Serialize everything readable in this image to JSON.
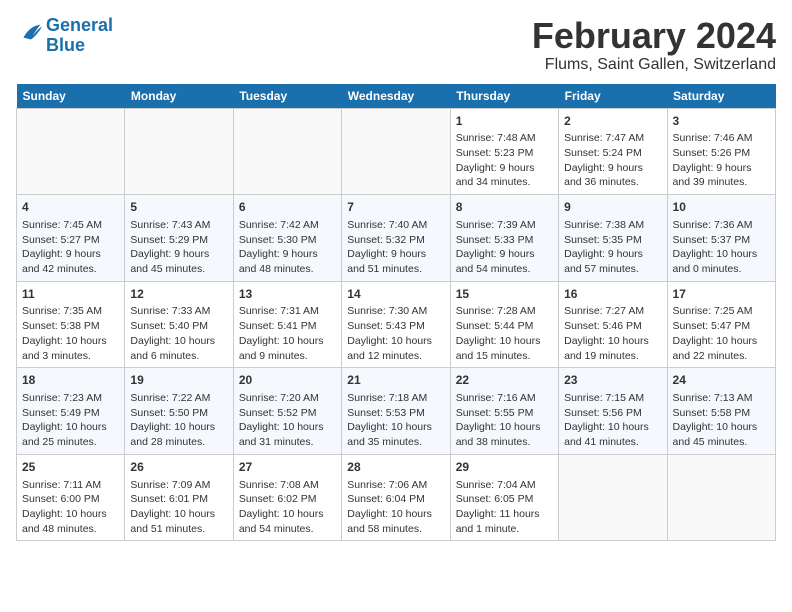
{
  "header": {
    "logo_line1": "General",
    "logo_line2": "Blue",
    "month": "February 2024",
    "location": "Flums, Saint Gallen, Switzerland"
  },
  "days_of_week": [
    "Sunday",
    "Monday",
    "Tuesday",
    "Wednesday",
    "Thursday",
    "Friday",
    "Saturday"
  ],
  "weeks": [
    [
      {
        "day": "",
        "info": ""
      },
      {
        "day": "",
        "info": ""
      },
      {
        "day": "",
        "info": ""
      },
      {
        "day": "",
        "info": ""
      },
      {
        "day": "1",
        "info": "Sunrise: 7:48 AM\nSunset: 5:23 PM\nDaylight: 9 hours and 34 minutes."
      },
      {
        "day": "2",
        "info": "Sunrise: 7:47 AM\nSunset: 5:24 PM\nDaylight: 9 hours and 36 minutes."
      },
      {
        "day": "3",
        "info": "Sunrise: 7:46 AM\nSunset: 5:26 PM\nDaylight: 9 hours and 39 minutes."
      }
    ],
    [
      {
        "day": "4",
        "info": "Sunrise: 7:45 AM\nSunset: 5:27 PM\nDaylight: 9 hours and 42 minutes."
      },
      {
        "day": "5",
        "info": "Sunrise: 7:43 AM\nSunset: 5:29 PM\nDaylight: 9 hours and 45 minutes."
      },
      {
        "day": "6",
        "info": "Sunrise: 7:42 AM\nSunset: 5:30 PM\nDaylight: 9 hours and 48 minutes."
      },
      {
        "day": "7",
        "info": "Sunrise: 7:40 AM\nSunset: 5:32 PM\nDaylight: 9 hours and 51 minutes."
      },
      {
        "day": "8",
        "info": "Sunrise: 7:39 AM\nSunset: 5:33 PM\nDaylight: 9 hours and 54 minutes."
      },
      {
        "day": "9",
        "info": "Sunrise: 7:38 AM\nSunset: 5:35 PM\nDaylight: 9 hours and 57 minutes."
      },
      {
        "day": "10",
        "info": "Sunrise: 7:36 AM\nSunset: 5:37 PM\nDaylight: 10 hours and 0 minutes."
      }
    ],
    [
      {
        "day": "11",
        "info": "Sunrise: 7:35 AM\nSunset: 5:38 PM\nDaylight: 10 hours and 3 minutes."
      },
      {
        "day": "12",
        "info": "Sunrise: 7:33 AM\nSunset: 5:40 PM\nDaylight: 10 hours and 6 minutes."
      },
      {
        "day": "13",
        "info": "Sunrise: 7:31 AM\nSunset: 5:41 PM\nDaylight: 10 hours and 9 minutes."
      },
      {
        "day": "14",
        "info": "Sunrise: 7:30 AM\nSunset: 5:43 PM\nDaylight: 10 hours and 12 minutes."
      },
      {
        "day": "15",
        "info": "Sunrise: 7:28 AM\nSunset: 5:44 PM\nDaylight: 10 hours and 15 minutes."
      },
      {
        "day": "16",
        "info": "Sunrise: 7:27 AM\nSunset: 5:46 PM\nDaylight: 10 hours and 19 minutes."
      },
      {
        "day": "17",
        "info": "Sunrise: 7:25 AM\nSunset: 5:47 PM\nDaylight: 10 hours and 22 minutes."
      }
    ],
    [
      {
        "day": "18",
        "info": "Sunrise: 7:23 AM\nSunset: 5:49 PM\nDaylight: 10 hours and 25 minutes."
      },
      {
        "day": "19",
        "info": "Sunrise: 7:22 AM\nSunset: 5:50 PM\nDaylight: 10 hours and 28 minutes."
      },
      {
        "day": "20",
        "info": "Sunrise: 7:20 AM\nSunset: 5:52 PM\nDaylight: 10 hours and 31 minutes."
      },
      {
        "day": "21",
        "info": "Sunrise: 7:18 AM\nSunset: 5:53 PM\nDaylight: 10 hours and 35 minutes."
      },
      {
        "day": "22",
        "info": "Sunrise: 7:16 AM\nSunset: 5:55 PM\nDaylight: 10 hours and 38 minutes."
      },
      {
        "day": "23",
        "info": "Sunrise: 7:15 AM\nSunset: 5:56 PM\nDaylight: 10 hours and 41 minutes."
      },
      {
        "day": "24",
        "info": "Sunrise: 7:13 AM\nSunset: 5:58 PM\nDaylight: 10 hours and 45 minutes."
      }
    ],
    [
      {
        "day": "25",
        "info": "Sunrise: 7:11 AM\nSunset: 6:00 PM\nDaylight: 10 hours and 48 minutes."
      },
      {
        "day": "26",
        "info": "Sunrise: 7:09 AM\nSunset: 6:01 PM\nDaylight: 10 hours and 51 minutes."
      },
      {
        "day": "27",
        "info": "Sunrise: 7:08 AM\nSunset: 6:02 PM\nDaylight: 10 hours and 54 minutes."
      },
      {
        "day": "28",
        "info": "Sunrise: 7:06 AM\nSunset: 6:04 PM\nDaylight: 10 hours and 58 minutes."
      },
      {
        "day": "29",
        "info": "Sunrise: 7:04 AM\nSunset: 6:05 PM\nDaylight: 11 hours and 1 minute."
      },
      {
        "day": "",
        "info": ""
      },
      {
        "day": "",
        "info": ""
      }
    ]
  ]
}
